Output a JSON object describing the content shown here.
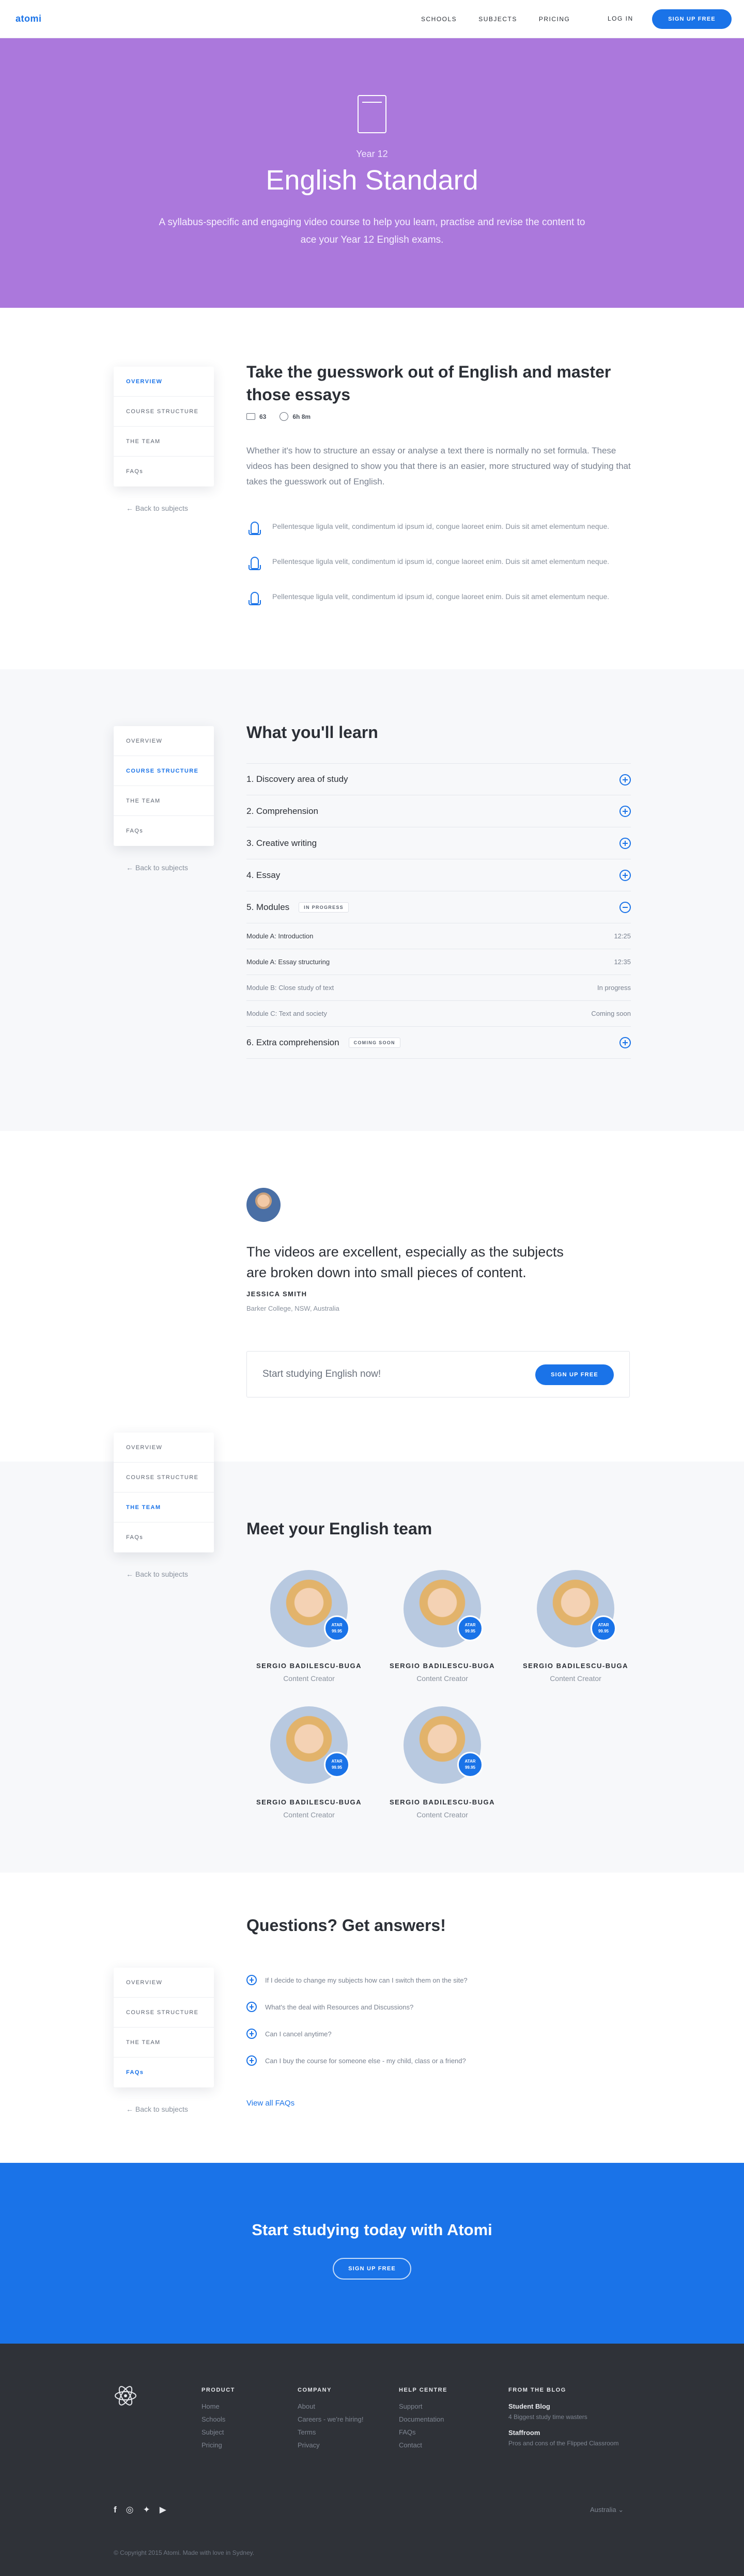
{
  "nav": {
    "logo": "atomi",
    "links": [
      "SCHOOLS",
      "SUBJECTS",
      "PRICING"
    ],
    "login": "LOG IN",
    "signup": "SIGN UP FREE"
  },
  "hero": {
    "year": "Year 12",
    "title": "English Standard",
    "subtitle": "A syllabus-specific and engaging video course to help you learn, practise and revise the content to ace your Year 12 English exams.",
    "color": "#ab78dc"
  },
  "sidebar": {
    "items": [
      "OVERVIEW",
      "COURSE STRUCTURE",
      "THE TEAM",
      "FAQs"
    ],
    "back": "←  Back to subjects"
  },
  "overview": {
    "title": "Take the guesswork out of English and master those essays",
    "videos": "63",
    "duration": "6h 8m",
    "paragraph": "Whether it's how to structure an essay or analyse a text there is normally no set formula. These videos has been designed to show you that there is an easier, more structured way of studying that takes the guesswork out of English.",
    "bullets": [
      "Pellentesque ligula velit, condimentum id ipsum id, congue laoreet enim. Duis sit amet elementum neque.",
      "Pellentesque ligula velit, condimentum id ipsum id, congue laoreet enim. Duis sit amet elementum neque.",
      "Pellentesque ligula velit, condimentum id ipsum id, congue laoreet enim. Duis sit amet elementum neque."
    ]
  },
  "learn": {
    "title": "What you'll learn",
    "sections": [
      "1. Discovery area of study",
      "2. Comprehension",
      "3. Creative writing",
      "4. Essay",
      "5. Modules",
      "6. Extra comprehension"
    ],
    "modules_badge": "IN PROGRESS",
    "extra_badge": "COMING SOON",
    "modules": [
      {
        "name": "Module A: Introduction",
        "status": "12:25"
      },
      {
        "name": "Module A: Essay structuring",
        "status": "12:35"
      },
      {
        "name": "Module B: Close study of text",
        "status": "In progress"
      },
      {
        "name": "Module C: Text and society",
        "status": "Coming soon"
      }
    ]
  },
  "testimonial": {
    "quote": "The videos are excellent, especially as the subjects are broken down into small pieces of content.",
    "name": "JESSICA SMITH",
    "place": "Barker College, NSW, Australia",
    "cta_text": "Start studying English now!",
    "cta_button": "SIGN UP FREE"
  },
  "team": {
    "title": "Meet your English team",
    "badge_line1": "ATAR",
    "badge_line2": "99.95",
    "members": [
      {
        "name": "SERGIO BADILESCU-BUGA",
        "role": "Content Creator"
      },
      {
        "name": "SERGIO BADILESCU-BUGA",
        "role": "Content Creator"
      },
      {
        "name": "SERGIO BADILESCU-BUGA",
        "role": "Content Creator"
      },
      {
        "name": "SERGIO BADILESCU-BUGA",
        "role": "Content Creator"
      },
      {
        "name": "SERGIO BADILESCU-BUGA",
        "role": "Content Creator"
      }
    ]
  },
  "faq": {
    "title": "Questions? Get answers!",
    "items": [
      "If I decide to change my subjects how can I switch them on the site?",
      "What's the deal with Resources and Discussions?",
      "Can I cancel anytime?",
      "Can I buy the course for someone else - my child, class or a friend?"
    ],
    "view_all": "View all FAQs"
  },
  "cta_banner": {
    "title": "Start studying today with Atomi",
    "button": "SIGN UP FREE"
  },
  "footer": {
    "product": {
      "head": "PRODUCT",
      "links": [
        "Home",
        "Schools",
        "Subject",
        "Pricing"
      ]
    },
    "company": {
      "head": "COMPANY",
      "links": [
        "About",
        "Careers - we're hiring!",
        "Terms",
        "Privacy"
      ]
    },
    "help": {
      "head": "HELP CENTRE",
      "links": [
        "Support",
        "Documentation",
        "FAQs",
        "Contact"
      ]
    },
    "blog": {
      "head": "FROM THE BLOG",
      "posts": [
        {
          "title": "Student Blog",
          "sub": "4 Biggest study time wasters"
        },
        {
          "title": "Staffroom",
          "sub": "Pros and cons of the Flipped Classroom"
        }
      ]
    },
    "socials": [
      "f",
      "◎",
      "✦",
      "▶"
    ],
    "region": "Australia  ⌄",
    "copyright": "© Copyright 2015 Atomi. Made with love in Sydney."
  }
}
